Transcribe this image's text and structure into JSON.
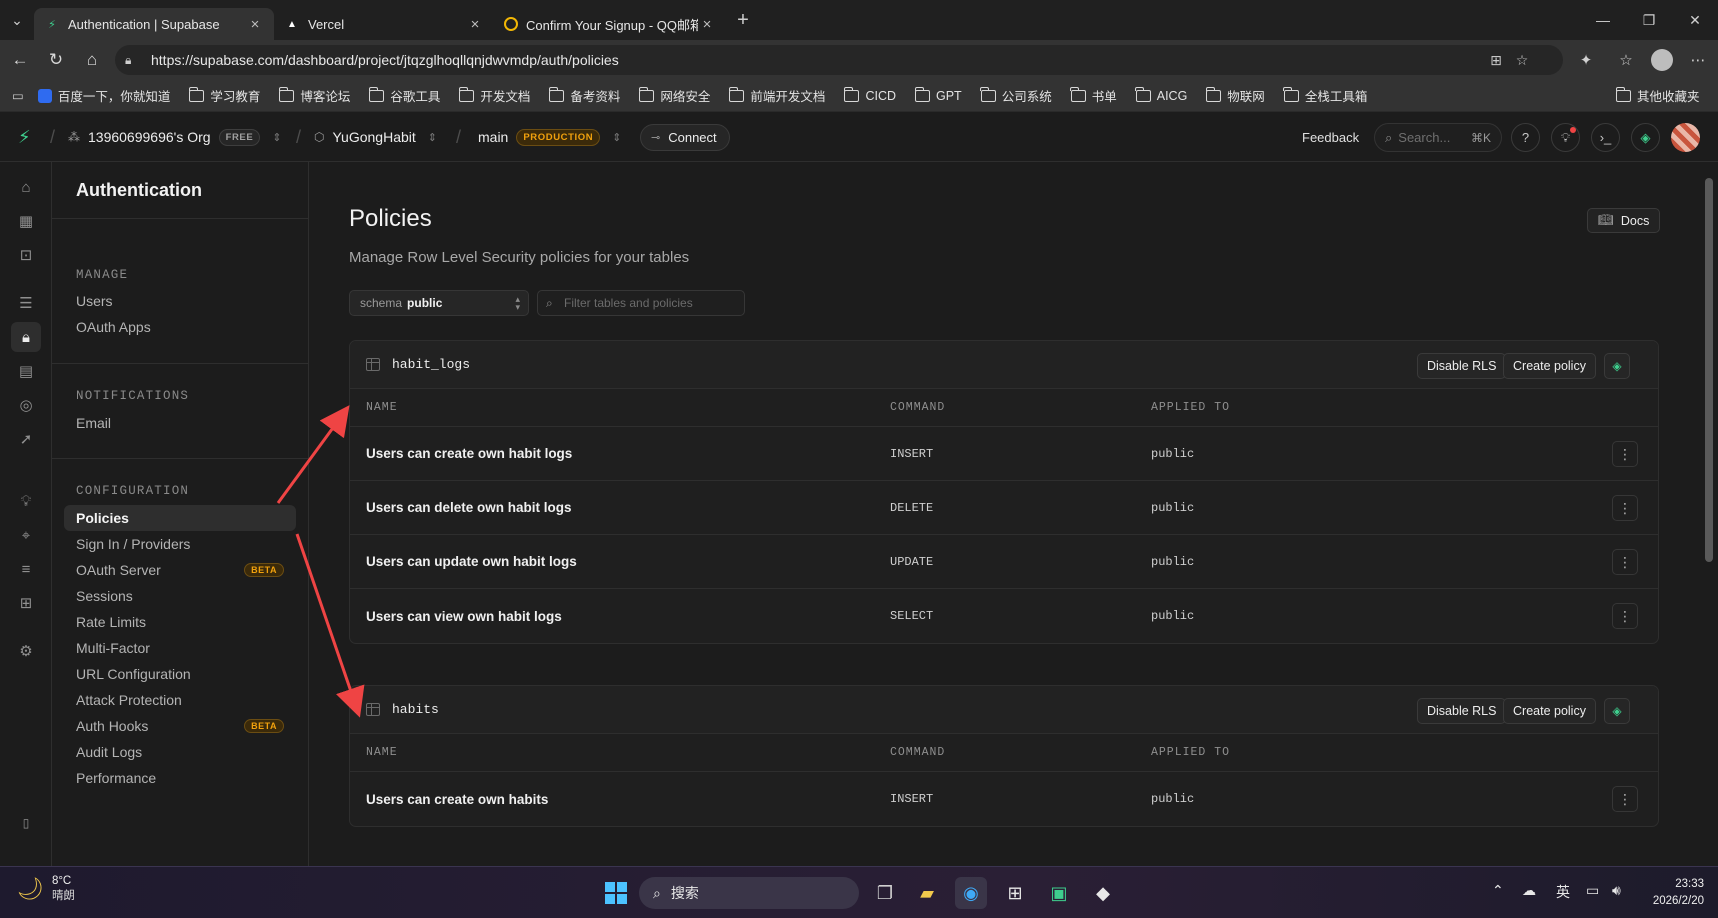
{
  "browser": {
    "tabs": [
      {
        "title": "Authentication | Supabase",
        "active": true
      },
      {
        "title": "Vercel",
        "active": false
      },
      {
        "title": "Confirm Your Signup - QQ邮箱",
        "active": false
      }
    ],
    "url": "https://supabase.com/dashboard/project/jtqzglhoqllqnjdwvmdp/auth/policies",
    "bookmarks": [
      "百度一下，你就知道",
      "学习教育",
      "博客论坛",
      "谷歌工具",
      "开发文档",
      "备考资料",
      "网络安全",
      "前端开发文档",
      "CICD",
      "GPT",
      "公司系统",
      "书单",
      "AICG",
      "物联网",
      "全栈工具箱"
    ],
    "other_bookmarks": "其他收藏夹"
  },
  "topnav": {
    "org": "13960699696's Org",
    "org_badge": "FREE",
    "project": "YuGongHabit",
    "branch": "main",
    "branch_badge": "PRODUCTION",
    "connect": "Connect",
    "feedback": "Feedback",
    "search_placeholder": "Search...",
    "search_shortcut": "⌘K"
  },
  "sidebar": {
    "title": "Authentication",
    "sections": [
      {
        "heading": "MANAGE",
        "items": [
          "Users",
          "OAuth Apps"
        ]
      },
      {
        "heading": "NOTIFICATIONS",
        "items": [
          "Email"
        ]
      },
      {
        "heading": "CONFIGURATION",
        "items": [
          "Policies",
          "Sign In / Providers",
          "OAuth Server",
          "Sessions",
          "Rate Limits",
          "Multi-Factor",
          "URL Configuration",
          "Attack Protection",
          "Auth Hooks",
          "Audit Logs",
          "Performance"
        ]
      }
    ],
    "beta_label": "BETA",
    "active_item": "Policies"
  },
  "main": {
    "title": "Policies",
    "subtitle": "Manage Row Level Security policies for your tables",
    "docs": "Docs",
    "schema_label": "schema",
    "schema_value": "public",
    "filter_placeholder": "Filter tables and policies",
    "disable_rls": "Disable RLS",
    "create_policy": "Create policy",
    "columns": [
      "NAME",
      "COMMAND",
      "APPLIED TO"
    ],
    "tables": [
      {
        "name": "habit_logs",
        "policies": [
          {
            "name": "Users can create own habit logs",
            "command": "INSERT",
            "applied_to": "public"
          },
          {
            "name": "Users can delete own habit logs",
            "command": "DELETE",
            "applied_to": "public"
          },
          {
            "name": "Users can update own habit logs",
            "command": "UPDATE",
            "applied_to": "public"
          },
          {
            "name": "Users can view own habit logs",
            "command": "SELECT",
            "applied_to": "public"
          }
        ]
      },
      {
        "name": "habits",
        "policies": [
          {
            "name": "Users can create own habits",
            "command": "INSERT",
            "applied_to": "public"
          }
        ]
      }
    ]
  },
  "taskbar": {
    "temperature": "8°C",
    "condition": "晴朗",
    "search": "搜索",
    "ime": "英",
    "time": "23:33",
    "date": "2026/2/20"
  },
  "colors": {
    "accent": "#3ecf8e",
    "warning": "#f1a10d",
    "annotation_arrow": "#ef4444"
  }
}
